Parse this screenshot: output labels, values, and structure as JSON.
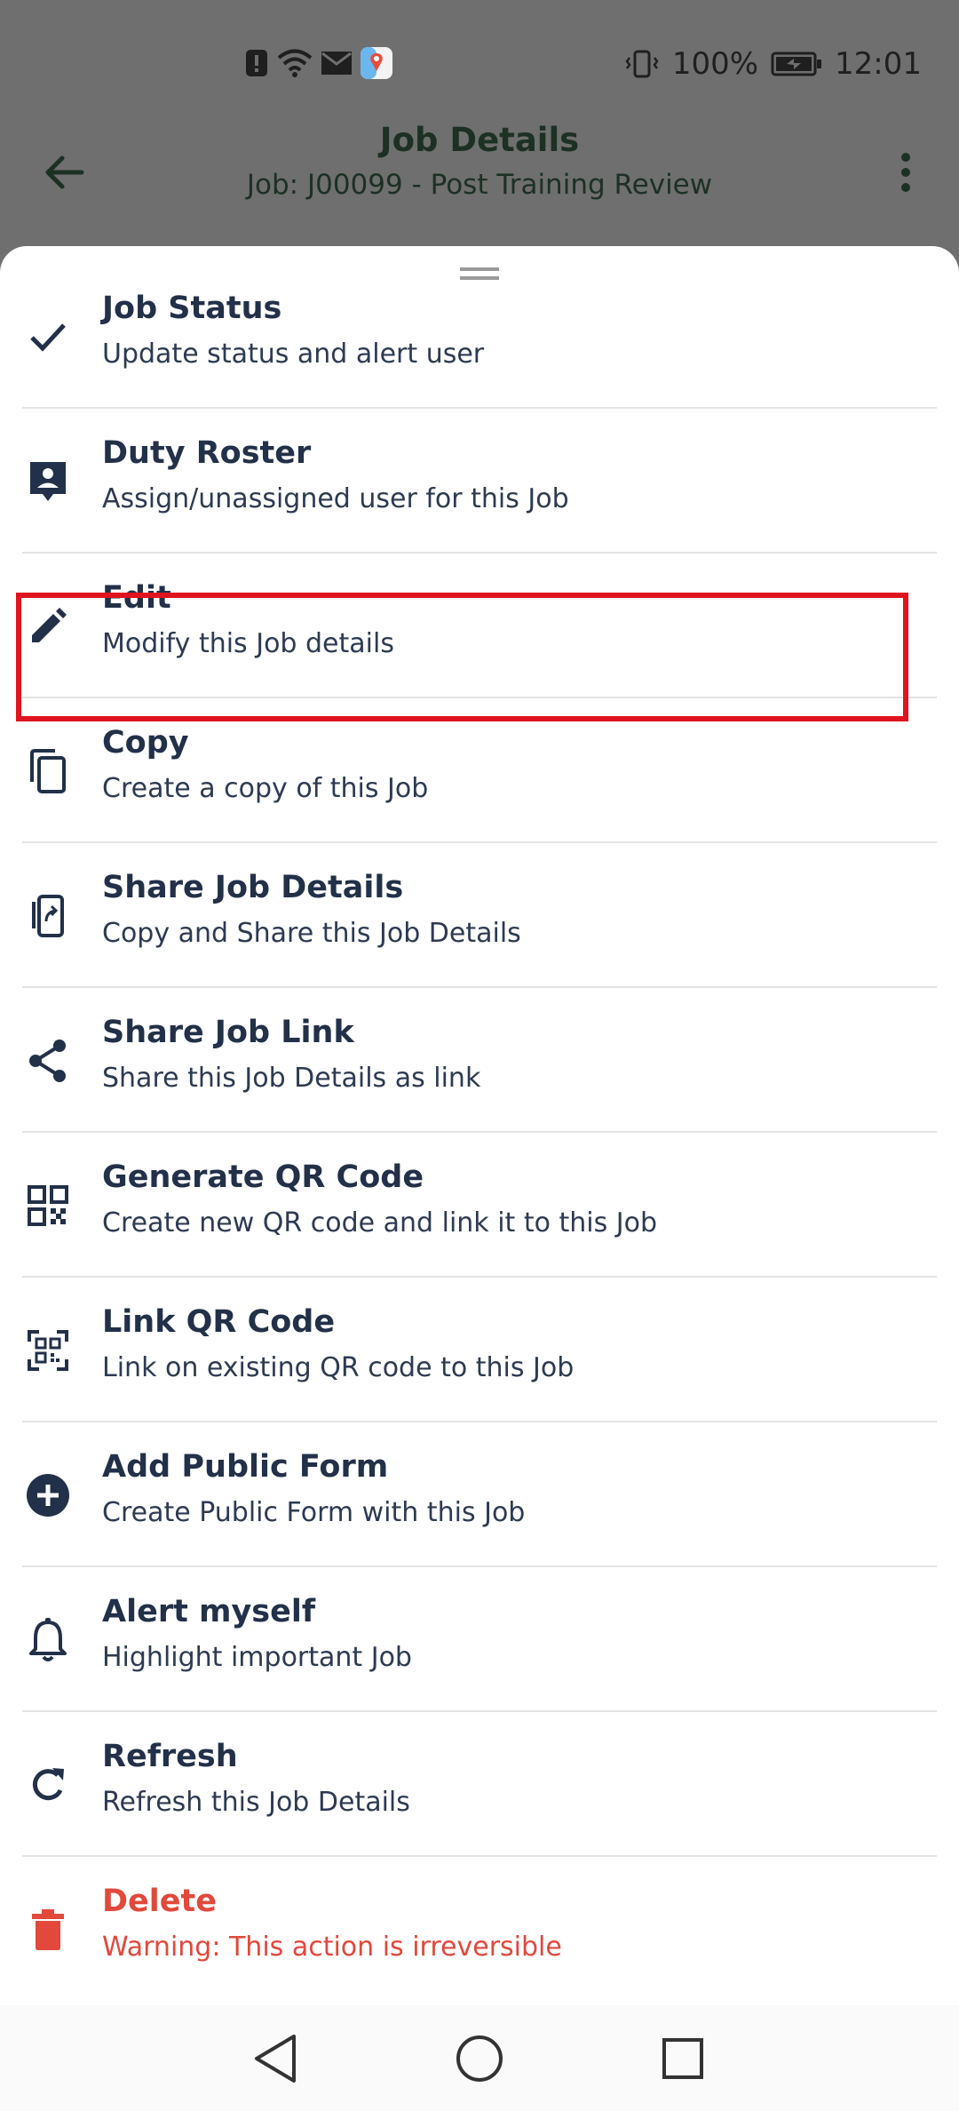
{
  "status_bar": {
    "battery": "100%",
    "time": "12:01",
    "icons": [
      "alert-icon",
      "wifi-icon",
      "mail-icon",
      "maps-app-icon",
      "vibrate-icon",
      "battery-charging-icon"
    ]
  },
  "app_bar": {
    "title": "Job Details",
    "subtitle": "Job: J00099 - Post Training Review",
    "back_icon": "arrow-back-icon",
    "more_icon": "more-vert-icon"
  },
  "menu": {
    "items": [
      {
        "icon": "check-icon",
        "title": "Job Status",
        "desc": "Update status and alert user"
      },
      {
        "icon": "assignment-ind-icon",
        "title": "Duty Roster",
        "desc": "Assign/unassigned user for this Job"
      },
      {
        "icon": "edit-pencil-icon",
        "title": "Edit",
        "desc": "Modify this Job details"
      },
      {
        "icon": "copy-icon",
        "title": "Copy",
        "desc": "Create a copy of this Job"
      },
      {
        "icon": "share-document-icon",
        "title": "Share Job Details",
        "desc": "Copy and Share this Job Details"
      },
      {
        "icon": "share-icon",
        "title": "Share Job Link",
        "desc": "Share this Job Details as link"
      },
      {
        "icon": "qr-code-icon",
        "title": "Generate QR Code",
        "desc": "Create new QR code and link it to this Job"
      },
      {
        "icon": "qr-scan-icon",
        "title": "Link QR Code",
        "desc": "Link on existing QR code to this Job"
      },
      {
        "icon": "add-circle-icon",
        "title": "Add Public Form",
        "desc": "Create Public Form with this Job"
      },
      {
        "icon": "bell-icon",
        "title": "Alert myself",
        "desc": "Highlight important Job"
      },
      {
        "icon": "refresh-icon",
        "title": "Refresh",
        "desc": "Refresh this Job Details"
      },
      {
        "icon": "trash-icon",
        "title": "Delete",
        "desc": "Warning: This action is irreversible"
      }
    ]
  },
  "colors": {
    "text": "#223049",
    "danger": "#e2483b",
    "highlight": "#e0141e",
    "scrim": "#6f6f6f"
  },
  "nav_bar": {
    "icons": [
      "nav-back-icon",
      "nav-home-icon",
      "nav-recents-icon"
    ]
  }
}
